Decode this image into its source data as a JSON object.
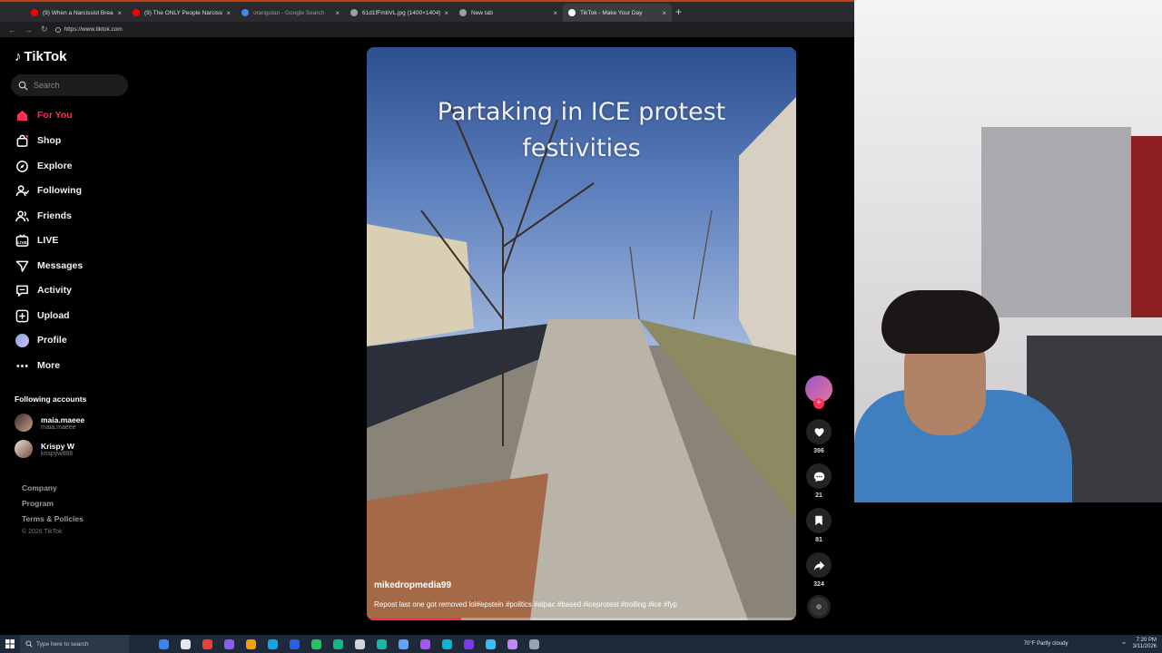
{
  "browser": {
    "tabs": [
      {
        "title": "(9) When a Narcissist Breaks the Silence",
        "icon": "youtube-icon",
        "color": "#ff0000"
      },
      {
        "title": "(9) The ONLY People Narcissists Stay With",
        "icon": "youtube-icon",
        "color": "#ff0000"
      },
      {
        "title": "orangutan - Google Search",
        "icon": "google-icon",
        "color": "#4285f4"
      },
      {
        "title": "61d1fFmbVL.jpg (1400×1404)",
        "icon": "image-icon",
        "color": "#9aa0a6"
      },
      {
        "title": "New tab",
        "icon": "newtab-icon",
        "color": "#9aa0a6"
      },
      {
        "title": "TikTok - Make Your Day",
        "icon": "tiktok-icon",
        "color": "#ffffff"
      }
    ],
    "close_glyph": "×",
    "new_tab_glyph": "+",
    "url": "https://www.tiktok.com"
  },
  "tiktok": {
    "logo": "TikTok",
    "search_placeholder": "Search",
    "nav": [
      {
        "label": "For You",
        "icon": "home-icon"
      },
      {
        "label": "Shop",
        "icon": "shop-bag-icon"
      },
      {
        "label": "Explore",
        "icon": "compass-icon"
      },
      {
        "label": "Following",
        "icon": "following-icon"
      },
      {
        "label": "Friends",
        "icon": "friends-icon"
      },
      {
        "label": "LIVE",
        "icon": "live-icon"
      },
      {
        "label": "Messages",
        "icon": "messages-icon"
      },
      {
        "label": "Activity",
        "icon": "activity-icon"
      },
      {
        "label": "Upload",
        "icon": "upload-icon"
      },
      {
        "label": "Profile",
        "icon": "profile-avatar"
      },
      {
        "label": "More",
        "icon": "more-icon"
      }
    ],
    "following_title": "Following accounts",
    "following_accounts": [
      {
        "name": "maia.maeee",
        "handle": "maia.maeee"
      },
      {
        "name": "Krispy W",
        "handle": "krispyw888"
      }
    ],
    "footer": [
      "Company",
      "Program",
      "Terms & Policies"
    ],
    "copyright": "© 2026 TikTok",
    "accent": "#fe2c55"
  },
  "video": {
    "overlay_text": "Partaking in ICE protest festivities",
    "author": "mikedropmedia99",
    "caption": "Repost last one got removed lol#epstein #politics #alpac #based #iceprotest #trolling #ice #fyp",
    "progress": 0.22,
    "likes": "396",
    "comments": "21",
    "saves": "81",
    "shares": "324"
  },
  "taskbar": {
    "search_placeholder": "Type here to search",
    "weather": "70°F  Partly cloudy",
    "time": "7:20 PM",
    "date": "3/11/2026",
    "apps": [
      "#3b82f6",
      "#e5e7eb",
      "#ea4335",
      "#8b5cf6",
      "#f59e0b",
      "#0ea5e9",
      "#2563eb",
      "#22c55e",
      "#10b981",
      "#d1d5db",
      "#14b8a6",
      "#60a5fa",
      "#a855f7",
      "#06b6d4",
      "#7c3aed",
      "#38bdf8",
      "#c084fc",
      "#94a3b8"
    ]
  }
}
